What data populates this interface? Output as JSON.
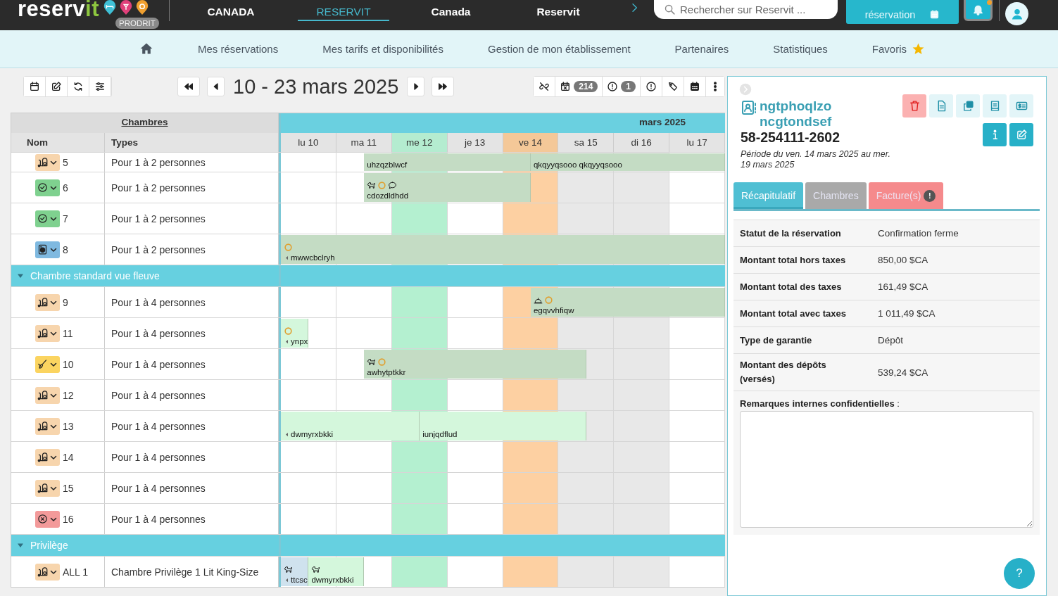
{
  "topbar": {
    "logo": {
      "main": "reserv",
      "accent": "it"
    },
    "badge": "PRODRIT",
    "nav": [
      {
        "label": "CANADA",
        "selected": false
      },
      {
        "label": "RESERVIT",
        "selected": true
      },
      {
        "label": "Canada",
        "selected": false
      },
      {
        "label": "Reservit",
        "selected": false
      }
    ],
    "search": {
      "placeholder": "Rechercher sur Reservit ..."
    },
    "book_button": "réservation",
    "notifications": {
      "unread": true
    }
  },
  "menu": [
    {
      "kind": "home"
    },
    {
      "kind": "link",
      "label": "Mes réservations"
    },
    {
      "kind": "link",
      "label": "Mes tarifs et disponibilités"
    },
    {
      "kind": "link",
      "label": "Gestion de mon établissement"
    },
    {
      "kind": "link",
      "label": "Partenaires"
    },
    {
      "kind": "link",
      "label": "Statistiques"
    },
    {
      "kind": "favorites",
      "label": "Favoris"
    }
  ],
  "toolbar": {
    "period": "10 - 23 mars 2025",
    "cancelled_count": "214",
    "alert_count": "1"
  },
  "planning": {
    "section": "Chambres",
    "month": "mars 2025",
    "columns": [
      "Nom",
      "Types"
    ],
    "days": [
      {
        "label": "lu 10",
        "kind": "normal"
      },
      {
        "label": "ma 11",
        "kind": "normal"
      },
      {
        "label": "me 12",
        "kind": "today"
      },
      {
        "label": "je 13",
        "kind": "normal"
      },
      {
        "label": "ve 14",
        "kind": "selected"
      },
      {
        "label": "sa 15",
        "kind": "weekend"
      },
      {
        "label": "di 16",
        "kind": "weekend"
      },
      {
        "label": "lu 17",
        "kind": "normal"
      }
    ],
    "rows": [
      {
        "kind": "room",
        "status": {
          "kind": "cleaning"
        },
        "number": "5",
        "type": "Pour 1 à 2 personnes",
        "slots": [
          {
            "kind": "free"
          },
          {
            "kind": "free"
          },
          {
            "kind": "free"
          },
          {
            "kind": "booking",
            "name": "uhzqzblwcf",
            "continues_before": false,
            "color": "#c4dcc4"
          },
          {
            "kind": "continued"
          },
          {
            "kind": "continued"
          },
          {
            "kind": "continued"
          },
          {
            "kind": "continued"
          },
          {
            "kind": "continued"
          },
          {
            "kind": "booking",
            "name": "qkqyyqsooo qkqyyqsooo",
            "continues_before": false,
            "color": "#c4dcc4"
          },
          {
            "kind": "continued"
          },
          {
            "kind": "continued"
          },
          {
            "kind": "continued"
          },
          {
            "kind": "continued"
          },
          {
            "kind": "continued"
          },
          {
            "kind": "continued"
          }
        ]
      },
      {
        "kind": "room",
        "status": {
          "kind": "clean"
        },
        "number": "6",
        "type": "Pour 1 à 2 personnes",
        "slots": [
          {
            "kind": "free"
          },
          {
            "kind": "free"
          },
          {
            "kind": "free"
          },
          {
            "kind": "booking",
            "name": "cdozdldhdd",
            "continues_before": false,
            "color": "#c4dcc4",
            "markers": [
              {
                "kind": "pet"
              },
              {
                "kind": "pending"
              },
              {
                "kind": "note"
              }
            ]
          },
          {
            "kind": "continued"
          },
          {
            "kind": "continued"
          },
          {
            "kind": "continued"
          },
          {
            "kind": "continued"
          },
          {
            "kind": "continued"
          }
        ]
      },
      {
        "kind": "room",
        "status": {
          "kind": "clean"
        },
        "number": "7",
        "type": "Pour 1 à 2 personnes"
      },
      {
        "kind": "room",
        "status": {
          "kind": "laundry"
        },
        "number": "8",
        "type": "Pour 1 à 2 personnes",
        "slots": [
          {
            "kind": "booking",
            "name": "mwwcbclryh",
            "continues_before": true,
            "color": "#c4dcc4",
            "markers": [
              {
                "kind": "pending"
              }
            ]
          },
          {
            "kind": "continued"
          },
          {
            "kind": "continued"
          },
          {
            "kind": "continued"
          },
          {
            "kind": "continued"
          },
          {
            "kind": "continued"
          },
          {
            "kind": "continued"
          },
          {
            "kind": "continued"
          },
          {
            "kind": "continued"
          },
          {
            "kind": "continued"
          },
          {
            "kind": "continued"
          },
          {
            "kind": "continued"
          },
          {
            "kind": "continued"
          },
          {
            "kind": "continued"
          },
          {
            "kind": "continued"
          },
          {
            "kind": "continued"
          }
        ]
      },
      {
        "kind": "group",
        "label": "Chambre standard vue fleuve",
        "expanded": true
      },
      {
        "kind": "room",
        "status": {
          "kind": "cleaning"
        },
        "number": "9",
        "type": "Pour 1 à 4 personnes",
        "slots": [
          {
            "kind": "free"
          },
          {
            "kind": "free"
          },
          {
            "kind": "free"
          },
          {
            "kind": "free"
          },
          {
            "kind": "free"
          },
          {
            "kind": "free"
          },
          {
            "kind": "free"
          },
          {
            "kind": "free"
          },
          {
            "kind": "free"
          },
          {
            "kind": "booking",
            "name": "egqvvhfiqw",
            "continues_before": false,
            "color": "#c4dcc4",
            "markers": [
              {
                "kind": "service"
              },
              {
                "kind": "pending"
              }
            ]
          },
          {
            "kind": "continued"
          },
          {
            "kind": "continued"
          },
          {
            "kind": "continued"
          },
          {
            "kind": "continued"
          },
          {
            "kind": "continued"
          },
          {
            "kind": "continued"
          }
        ]
      },
      {
        "kind": "room",
        "status": {
          "kind": "cleaning"
        },
        "number": "11",
        "type": "Pour 1 à 4 personnes",
        "slots": [
          {
            "kind": "booking",
            "name": "ynpx",
            "continues_before": true,
            "color": "#d4f7dc",
            "markers": [
              {
                "kind": "pending"
              }
            ]
          }
        ]
      },
      {
        "kind": "room",
        "status": {
          "kind": "brush"
        },
        "number": "10",
        "type": "Pour 1 à 4 personnes",
        "slots": [
          {
            "kind": "free"
          },
          {
            "kind": "free"
          },
          {
            "kind": "free"
          },
          {
            "kind": "booking",
            "name": "awhytptkkr",
            "continues_before": false,
            "color": "#c4dcc4",
            "markers": [
              {
                "kind": "pet"
              },
              {
                "kind": "pending"
              }
            ]
          },
          {
            "kind": "continued"
          },
          {
            "kind": "continued"
          },
          {
            "kind": "continued"
          },
          {
            "kind": "continued"
          },
          {
            "kind": "continued"
          },
          {
            "kind": "continued"
          },
          {
            "kind": "continued"
          }
        ]
      },
      {
        "kind": "room",
        "status": {
          "kind": "cleaning"
        },
        "number": "12",
        "type": "Pour 1 à 4 personnes"
      },
      {
        "kind": "room",
        "status": {
          "kind": "cleaning"
        },
        "number": "13",
        "type": "Pour 1 à 4 personnes",
        "slots": [
          {
            "kind": "booking",
            "name": "dwmyrxbkki",
            "continues_before": true,
            "color": "#d4f7dc"
          },
          {
            "kind": "continued"
          },
          {
            "kind": "continued"
          },
          {
            "kind": "continued"
          },
          {
            "kind": "continued"
          },
          {
            "kind": "booking",
            "name": "iunjqdflud",
            "continues_before": false,
            "color": "#d4f7dc"
          },
          {
            "kind": "continued"
          },
          {
            "kind": "continued"
          },
          {
            "kind": "continued"
          },
          {
            "kind": "continued"
          },
          {
            "kind": "continued"
          }
        ]
      },
      {
        "kind": "room",
        "status": {
          "kind": "cleaning"
        },
        "number": "14",
        "type": "Pour 1 à 4 personnes"
      },
      {
        "kind": "room",
        "status": {
          "kind": "cleaning"
        },
        "number": "15",
        "type": "Pour 1 à 4 personnes"
      },
      {
        "kind": "room",
        "status": {
          "kind": "closed"
        },
        "number": "16",
        "type": "Pour 1 à 4 personnes"
      },
      {
        "kind": "group",
        "label": "Privilège",
        "expanded": true
      },
      {
        "kind": "room",
        "status": {
          "kind": "cleaning"
        },
        "number": "ALL 1",
        "type": "Chambre Privilège 1 Lit King-Size",
        "slots": [
          {
            "kind": "booking",
            "name": "ttcsc",
            "continues_before": true,
            "color": "#cfe2ee",
            "markers": [
              {
                "kind": "pet"
              }
            ]
          },
          {
            "kind": "booking",
            "name": "dwmyrxbkki",
            "continues_before": false,
            "color": "#d4f7dc",
            "markers": [
              {
                "kind": "pet"
              }
            ]
          },
          {
            "kind": "continued"
          }
        ]
      }
    ]
  },
  "details": {
    "guest": "ngtphoqlzo ncgtondsef",
    "reference": "58-254111-2602",
    "period": "Période du ven. 14 mars 2025 au mer. 19 mars 2025",
    "tabs": [
      {
        "label": "Récapitulatif",
        "selected": true,
        "color": "#4fbfd3"
      },
      {
        "label": "Chambres",
        "selected": false,
        "color": "#a9a9a9"
      },
      {
        "label": "Facture(s)",
        "selected": false,
        "color": "#f58a8c",
        "badge": "!"
      }
    ],
    "summary": [
      {
        "label": "Statut de la réservation",
        "value": "Confirmation ferme"
      },
      {
        "label": "Montant total hors taxes",
        "value": "850,00 $CA"
      },
      {
        "label": "Montant total des taxes",
        "value": "161,49 $CA"
      },
      {
        "label": "Montant total avec taxes",
        "value": "1 011,49 $CA"
      },
      {
        "label": "Type de garantie",
        "value": "Dépôt"
      },
      {
        "label": "Montant des dépôts (versés)",
        "value": "539,24 $CA"
      }
    ],
    "notes_label": "**Remarques internes confidentielles** :",
    "help": "?"
  }
}
